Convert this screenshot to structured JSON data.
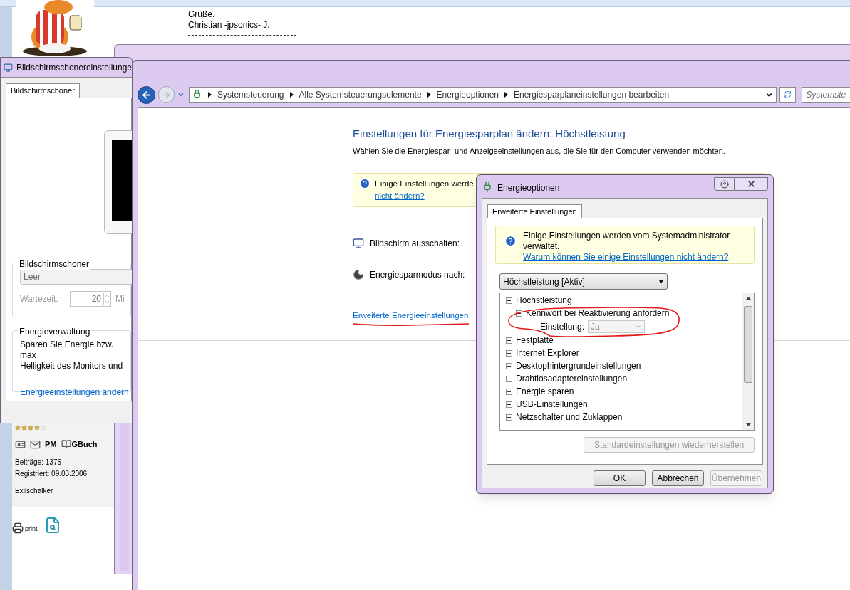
{
  "forum": {
    "signature": [
      "Grüße.",
      "Christian -jpsonics- J."
    ],
    "user": {
      "stars": 4,
      "pm": "PM",
      "guestbook": "GBuch",
      "posts": "Beiträge: 1375",
      "registered": "Registriert: 09.03.2006",
      "location": "Exilschalker",
      "print": "print"
    }
  },
  "screensaver_window": {
    "title": "Bildschirmschonereinstellunge",
    "tabs": [
      {
        "label": "Bildschirmschoner",
        "selected": true
      }
    ],
    "screensaver_group": {
      "title": "Bildschirmschoner",
      "value": "Leer",
      "wait_label": "Wartezeit:",
      "wait_value": "20",
      "unit": "Mi"
    },
    "power_group": {
      "title": "Energieverwaltung",
      "lines": [
        "Sparen Sie Energie bzw. max",
        "Helligkeit des Monitors und"
      ],
      "link": "Energieeinstellungen ändern"
    }
  },
  "control_panel": {
    "breadcrumb": [
      "Systemsteuerung",
      "Alle Systemsteuerungselemente",
      "Energieoptionen",
      "Energiesparplaneinstellungen bearbeiten"
    ],
    "search_placeholder": "Systemste",
    "heading": "Einstellungen für Energiesparplan ändern: Höchstleistung",
    "subheading": "Wählen Sie die Energiespar- und Anzeigeeinstellungen aus, die Sie für den Computer verwenden möchten.",
    "notice": {
      "text": "Einige Einstellungen werde",
      "link": "nicht ändern?"
    },
    "settings": [
      {
        "kind": "display",
        "label": "Bildschirm ausschalten:"
      },
      {
        "kind": "sleep",
        "label": "Energiesparmodus nach:"
      }
    ],
    "advanced_link": "Erweiterte Energieeinstellungen"
  },
  "dialog": {
    "title": "Energieoptionen",
    "tabs": [
      {
        "label": "Erweiterte Einstellungen",
        "selected": true
      }
    ],
    "notice": {
      "text": "Einige Einstellungen werden vom Systemadministrator verwaltet.",
      "link": "Warum können Sie einige Einstellungen nicht ändern?"
    },
    "plan": "Höchstleistung [Aktiv]",
    "tree": [
      {
        "label": "Höchstleistung",
        "expanded": true,
        "children": [
          {
            "label": "Kennwort bei Reaktivierung anfordern",
            "expanded": true,
            "children": [
              {
                "kind": "setting",
                "label": "Einstellung:",
                "value": "Ja",
                "disabled": true
              }
            ]
          }
        ]
      },
      {
        "label": "Festplatte",
        "expanded": false
      },
      {
        "label": "Internet Explorer",
        "expanded": false
      },
      {
        "label": "Desktophintergrundeinstellungen",
        "expanded": false
      },
      {
        "label": "Drahtlosadaptereinstellungen",
        "expanded": false
      },
      {
        "label": "Energie sparen",
        "expanded": false
      },
      {
        "label": "USB-Einstellungen",
        "expanded": false
      },
      {
        "label": "Netzschalter und Zuklappen",
        "expanded": false
      }
    ],
    "restore_button": {
      "label": "Standardeinstellungen wiederherstellen",
      "disabled": true
    },
    "buttons": [
      {
        "label": "OK",
        "disabled": false
      },
      {
        "label": "Abbrechen",
        "disabled": false
      },
      {
        "label": "Übernehmen",
        "disabled": true
      }
    ]
  }
}
